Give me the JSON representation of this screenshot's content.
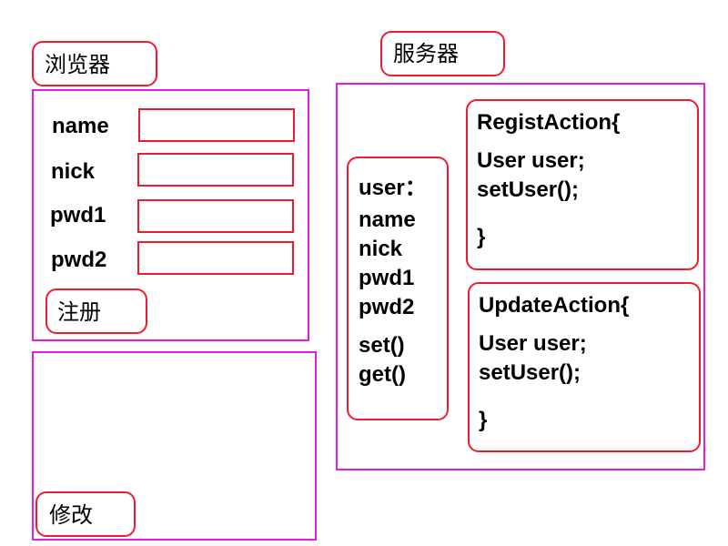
{
  "browser": {
    "title": "浏览器",
    "fields": [
      {
        "label": "name"
      },
      {
        "label": "nick"
      },
      {
        "label": "pwd1"
      },
      {
        "label": "pwd2"
      }
    ],
    "register_label": "注册",
    "modify_label": "修改"
  },
  "server": {
    "title": "服务器",
    "user": {
      "header": "user：",
      "fields": [
        "name",
        "nick",
        "pwd1",
        "pwd2"
      ],
      "methods": [
        "set()",
        "get()"
      ]
    },
    "regist_action": {
      "header": "RegistAction{",
      "lines": [
        "User user;",
        "setUser();"
      ],
      "close": "}"
    },
    "update_action": {
      "header": "UpdateAction{",
      "lines": [
        "User user;",
        "setUser();"
      ],
      "close": "}"
    }
  }
}
